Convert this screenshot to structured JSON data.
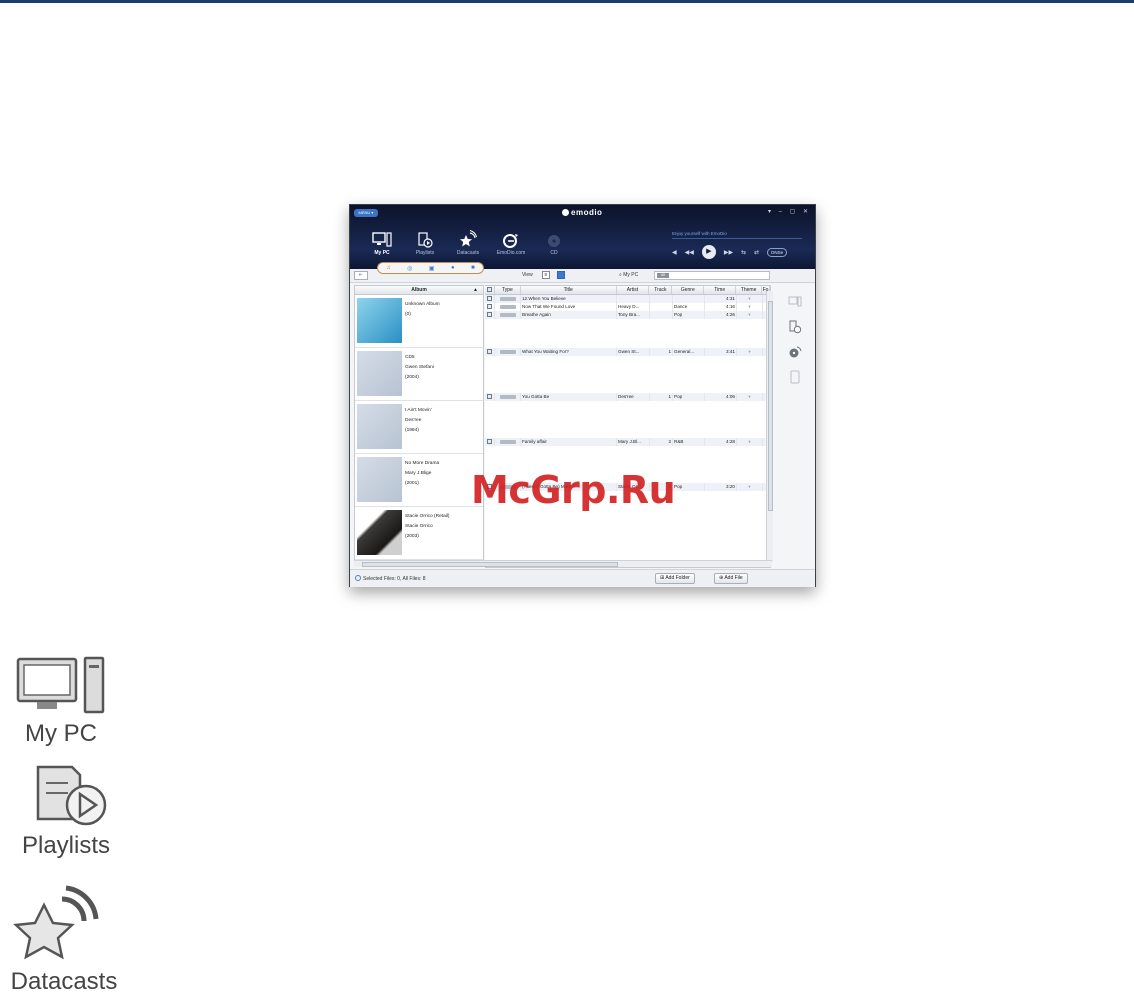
{
  "window": {
    "menu_label": "MENU ▾",
    "app_name": "emodio",
    "window_controls": "▾ – ▢ ✕",
    "tagline": "Enjoy yourself with EmoDio",
    "dnse_label": "DNSe"
  },
  "nav": [
    {
      "label": "My PC",
      "icon": "my-pc-icon"
    },
    {
      "label": "Playlists",
      "icon": "playlists-icon"
    },
    {
      "label": "Datacasts",
      "icon": "datacasts-icon"
    },
    {
      "label": "EmoDio.com",
      "icon": "emodio-icon"
    },
    {
      "label": "CD",
      "icon": "cd-icon"
    }
  ],
  "toolbar": {
    "view_label": "View",
    "location_label": "My PC",
    "search_tag": "All"
  },
  "album_panel": {
    "header": "Album",
    "albums": [
      {
        "line1": "Unknown Album",
        "line2": "",
        "line3": "(0)",
        "art": "emodio"
      },
      {
        "line1": "CD5",
        "line2": "Gwen Stefani",
        "line3": "(2004)",
        "art": "note"
      },
      {
        "line1": "I Ain't Movin'",
        "line2": "Des'ree",
        "line3": "(1994)",
        "art": "note"
      },
      {
        "line1": "No More Drama",
        "line2": "Mary J.Blige",
        "line3": "(2001)",
        "art": "note"
      },
      {
        "line1": "Stacie Orrico (Retail)",
        "line2": "Stacie Orrico",
        "line3": "(2003)",
        "art": "photo"
      }
    ]
  },
  "grid": {
    "headers": [
      "",
      "Type",
      "Title",
      "Artist",
      "Track",
      "Genre",
      "Time",
      "Theme",
      "Fo"
    ],
    "tracks": [
      {
        "title": "12.When You Believe",
        "artist": "",
        "track": "",
        "genre": "",
        "time": "4:31"
      },
      {
        "title": "Now That We Found Love",
        "artist": "Heavy D...",
        "track": "",
        "genre": "Dance",
        "time": "4:16"
      },
      {
        "title": "Breathe Again",
        "artist": "Tony Bra...",
        "track": "",
        "genre": "Pop",
        "time": "4:26"
      },
      {
        "title": "What You Waiting For?",
        "artist": "Gwen St...",
        "track": "1",
        "genre": "General...",
        "time": "3:41"
      },
      {
        "title": "You Gotta Be",
        "artist": "Des'ree",
        "track": "1",
        "genre": "Pop",
        "time": "4:06"
      },
      {
        "title": "Family affair",
        "artist": "Mary J.Bl...",
        "track": "2",
        "genre": "R&B",
        "time": "4:28"
      },
      {
        "title": "(There's Gotta Be) More T...",
        "artist": "Stacie Or...",
        "track": "2",
        "genre": "Pop",
        "time": "3:20"
      }
    ]
  },
  "status": {
    "text": "Selected Files: 0, All Files: 8",
    "add_folder": "Add Folder",
    "add_file": "Add File"
  },
  "watermark": "McGrp.Ru",
  "legend_icons": [
    {
      "label": "My PC",
      "icon": "my-pc-icon"
    },
    {
      "label": "Playlists",
      "icon": "playlists-icon"
    },
    {
      "label": "Datacasts",
      "icon": "datacasts-icon"
    }
  ],
  "colors": {
    "header_dark": "#0c1229",
    "accent_blue": "#3c79d1",
    "watermark_red": "#d21f1f"
  }
}
